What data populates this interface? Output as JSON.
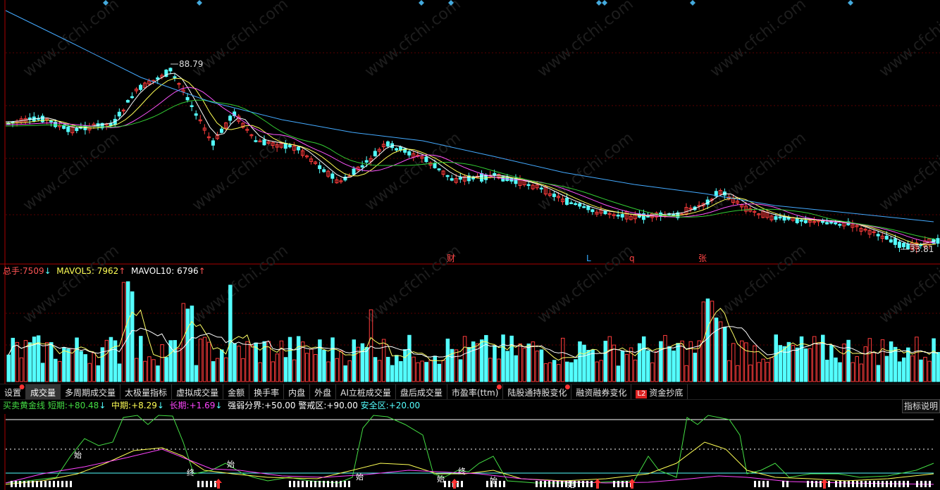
{
  "price_panel": {
    "high_label": "88.79",
    "low_label": "33.81",
    "event_markers": [
      {
        "text": "财",
        "color": "#ff4444"
      },
      {
        "text": "L",
        "color": "#33aaff"
      },
      {
        "text": "q",
        "color": "#ff4444"
      },
      {
        "text": "张",
        "color": "#ff4444"
      }
    ]
  },
  "volume_panel": {
    "total_label": "总手:",
    "total_value": "7509",
    "total_arrow": "↓",
    "mavol5_label": "MAVOL5:",
    "mavol5_value": "7962",
    "mavol5_arrow": "↑",
    "mavol10_label": "MAVOL10:",
    "mavol10_value": "6796",
    "mavol10_arrow": "↑"
  },
  "tabs": [
    {
      "label": "设置",
      "dot": true
    },
    {
      "label": "成交量",
      "active": true
    },
    {
      "label": "多周期成交量"
    },
    {
      "label": "太极量指标"
    },
    {
      "label": "虚拟成交量"
    },
    {
      "label": "金额"
    },
    {
      "label": "换手率"
    },
    {
      "label": "内盘"
    },
    {
      "label": "外盘"
    },
    {
      "label": "AI立桩成交量"
    },
    {
      "label": "盘后成交量"
    },
    {
      "label": "市盈率(ttm)",
      "dot": true
    },
    {
      "label": "陆股通持股变化",
      "dot": true
    },
    {
      "label": "融资融券变化"
    },
    {
      "label": "资金抄底",
      "badge": "L2"
    }
  ],
  "indicator_panel": {
    "name": "买卖黄金线",
    "short_label": "短期:",
    "short_value": "+80.48",
    "short_arrow": "↓",
    "mid_label": "中期:",
    "mid_value": "+8.29",
    "mid_arrow": "↓",
    "long_label": "长期:",
    "long_value": "+1.69",
    "long_arrow": "↓",
    "strength_label": "强弱分界:",
    "strength_value": "+50.00",
    "alert_label": "警戒区:",
    "alert_value": "+90.00",
    "safe_label": "安全区:",
    "safe_value": "+20.00",
    "explain_button": "指标说明",
    "signal_labels": [
      "始",
      "始",
      "终",
      "始",
      "终",
      "始",
      "始",
      "始"
    ]
  },
  "watermark": "www.cfchi.com",
  "colors": {
    "up": "#ff3c3c",
    "down": "#54ffff",
    "ma5": "#ffffff",
    "ma10": "#ffff55",
    "ma20": "#ff55ff",
    "ma30": "#33cc33",
    "ma60": "#44aaff",
    "grid": "#5a0000",
    "green_line": "#44dd44",
    "magenta_line": "#ff44ff"
  }
}
